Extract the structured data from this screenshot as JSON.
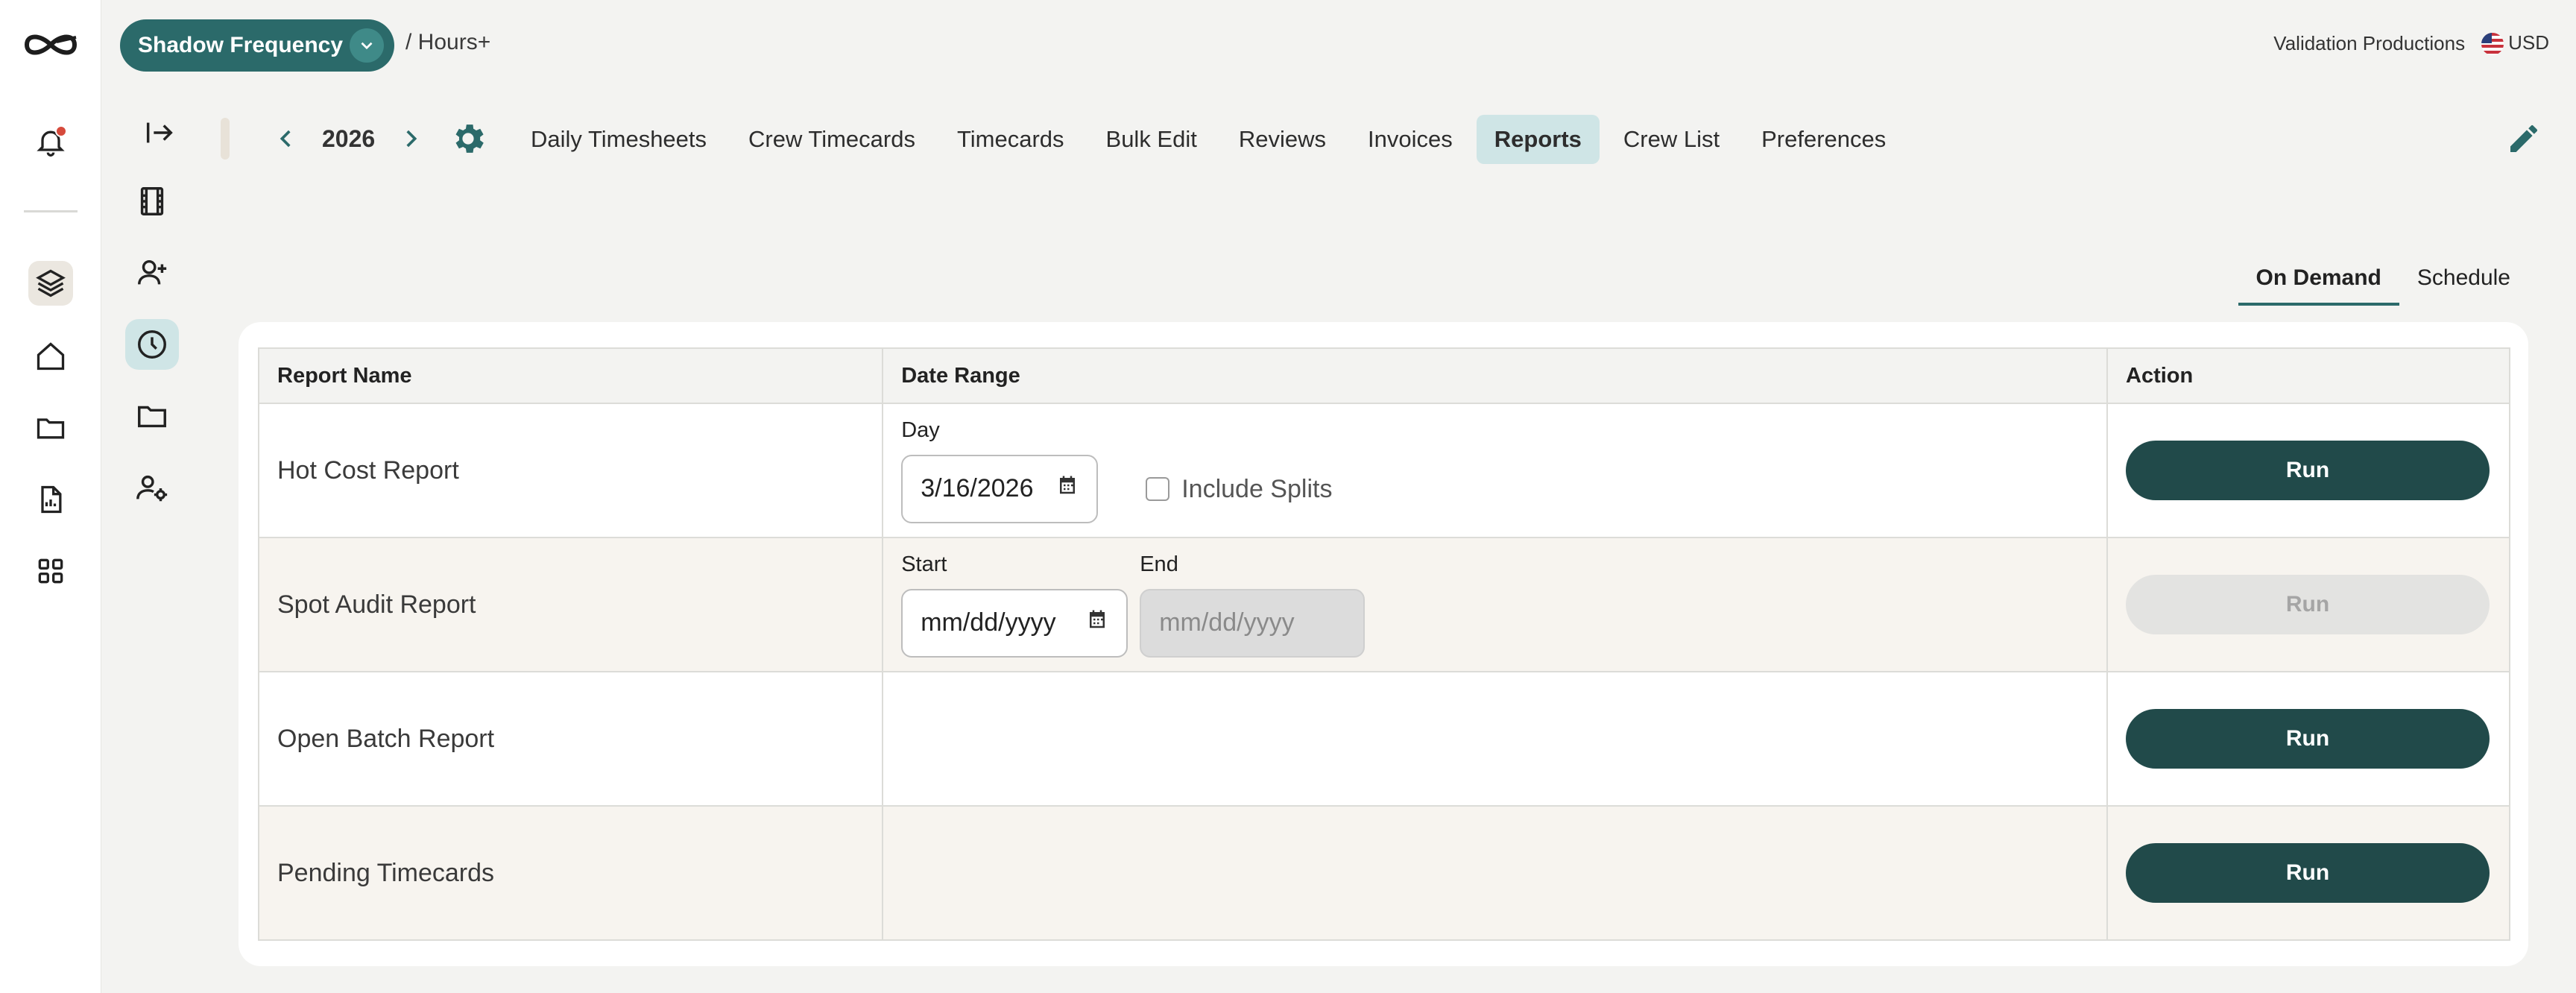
{
  "app": {
    "production_name": "Shadow Frequency",
    "breadcrumb": "/ Hours+",
    "company": "Validation Productions",
    "currency": "USD"
  },
  "nav": {
    "year": "2026",
    "tabs": [
      {
        "label": "Daily Timesheets",
        "active": false
      },
      {
        "label": "Crew Timecards",
        "active": false
      },
      {
        "label": "Timecards",
        "active": false
      },
      {
        "label": "Bulk Edit",
        "active": false
      },
      {
        "label": "Reviews",
        "active": false
      },
      {
        "label": "Invoices",
        "active": false
      },
      {
        "label": "Reports",
        "active": true
      },
      {
        "label": "Crew List",
        "active": false
      },
      {
        "label": "Preferences",
        "active": false
      }
    ]
  },
  "subtabs": {
    "on_demand": "On Demand",
    "schedule": "Schedule",
    "active": "On Demand"
  },
  "table": {
    "headers": [
      "Report Name",
      "Date Range",
      "Action"
    ],
    "rows": [
      {
        "name": "Hot Cost Report",
        "day_label": "Day",
        "day_value": "3/16/2026",
        "checkbox_label": "Include Splits",
        "checked": false,
        "action": "Run",
        "enabled": true
      },
      {
        "name": "Spot Audit Report",
        "start_label": "Start",
        "start_placeholder": "mm/dd/yyyy",
        "end_label": "End",
        "end_placeholder": "mm/dd/yyyy",
        "action": "Run",
        "enabled": false
      },
      {
        "name": "Open Batch Report",
        "action": "Run",
        "enabled": true
      },
      {
        "name": "Pending Timecards",
        "action": "Run",
        "enabled": true
      }
    ]
  },
  "icons": {
    "rail": [
      "logo-icon",
      "bell-icon",
      "layers-icon",
      "home-icon",
      "folder-icon",
      "report-file-icon",
      "apps-grid-icon"
    ],
    "rail2": [
      "expand-sidebar-icon",
      "film-icon",
      "add-user-icon",
      "clock-icon",
      "folder-icon",
      "user-settings-icon"
    ]
  },
  "colors": {
    "primary": "#214a4a",
    "accent_tab": "#cfe5e6",
    "pill": "#2b6a6a",
    "notification": "#d64a3c"
  }
}
